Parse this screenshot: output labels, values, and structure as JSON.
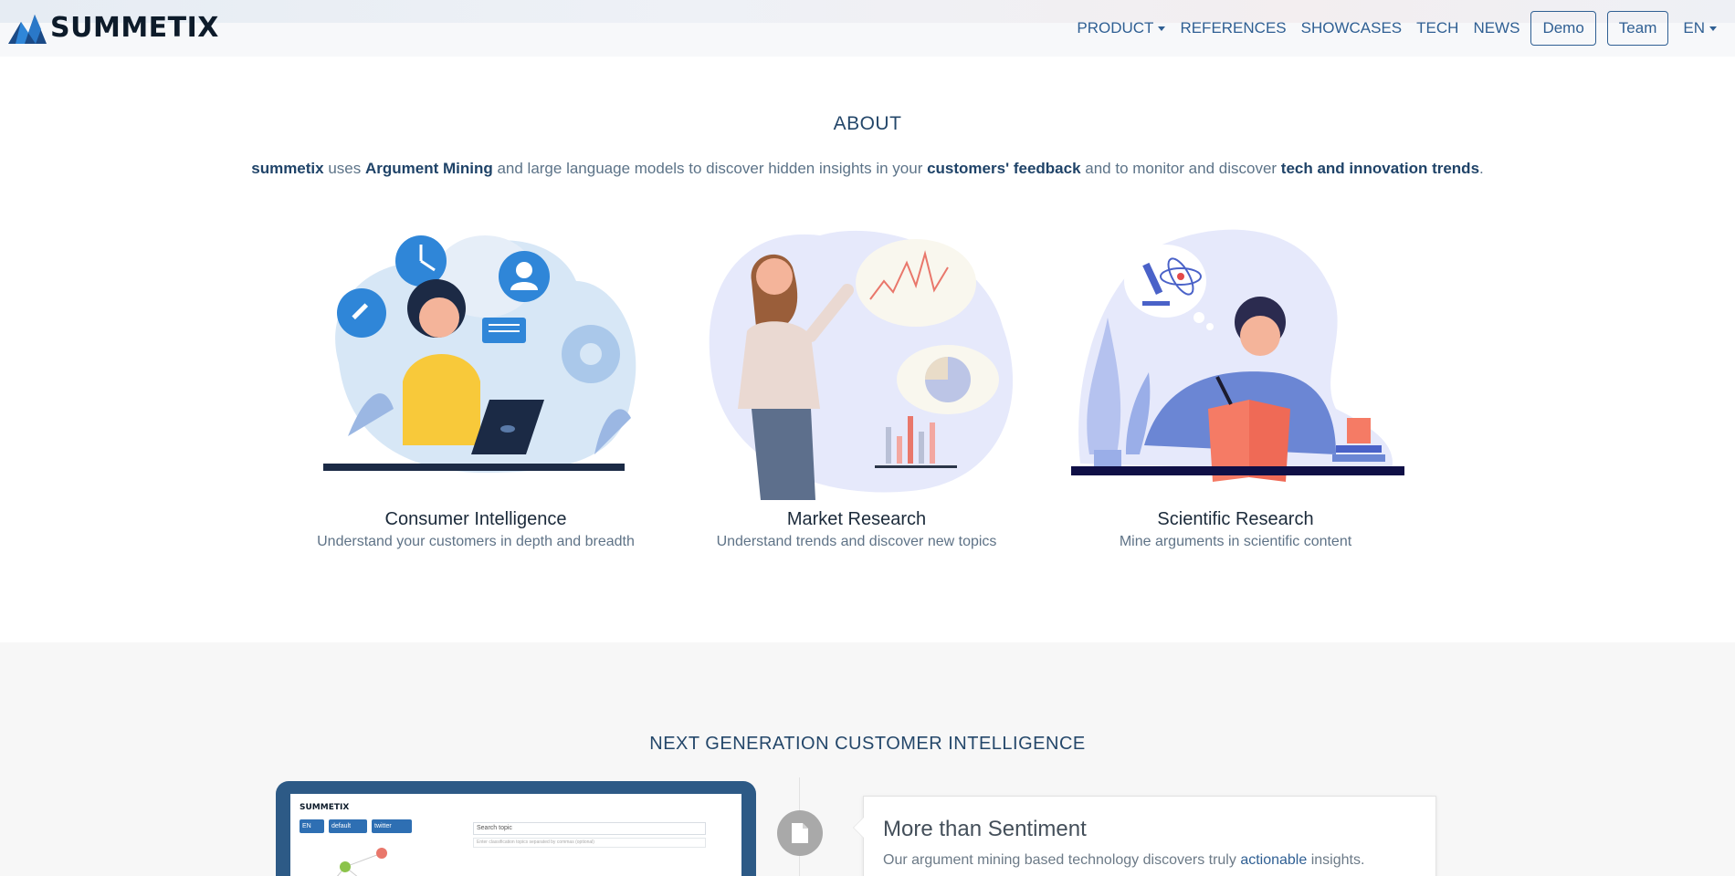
{
  "brand": {
    "name": "SUMMETIX",
    "logo_icon": "mountain-logo"
  },
  "nav": {
    "product": "PRODUCT",
    "references": "REFERENCES",
    "showcases": "SHOWCASES",
    "tech": "TECH",
    "news": "NEWS",
    "demo": "Demo",
    "team": "Team",
    "language": "EN"
  },
  "about": {
    "title": "ABOUT",
    "text": {
      "p1": "summetix",
      "p2": " uses ",
      "p3": "Argument Mining",
      "p4": " and large language models to discover hidden insights in your ",
      "p5": "customers' feedback",
      "p6": " and to monitor and discover ",
      "p7": "tech and innovation trends",
      "p8": "."
    },
    "features": [
      {
        "title": "Consumer Intelligence",
        "subtitle": "Understand your customers in depth and breadth"
      },
      {
        "title": "Market Research",
        "subtitle": "Understand trends and discover new topics"
      },
      {
        "title": "Scientific Research",
        "subtitle": "Mine arguments in scientific content"
      }
    ]
  },
  "ngci": {
    "title": "NEXT GENERATION CUSTOMER INTELLIGENCE",
    "preview": {
      "logo": "SUMMETIX",
      "lang": "EN",
      "select1": "default",
      "select2": "twitter",
      "search_placeholder": "Search topic",
      "hint": "Enter classification topics separated by commas (optional)"
    },
    "card": {
      "title": "More than Sentiment",
      "t1": "Our argument mining based technology discovers truly ",
      "t2": "actionable",
      "t3": " insights."
    }
  },
  "colors": {
    "accent": "#2f5f93",
    "heading": "#24476a",
    "section_bg": "#f7f7f7"
  }
}
